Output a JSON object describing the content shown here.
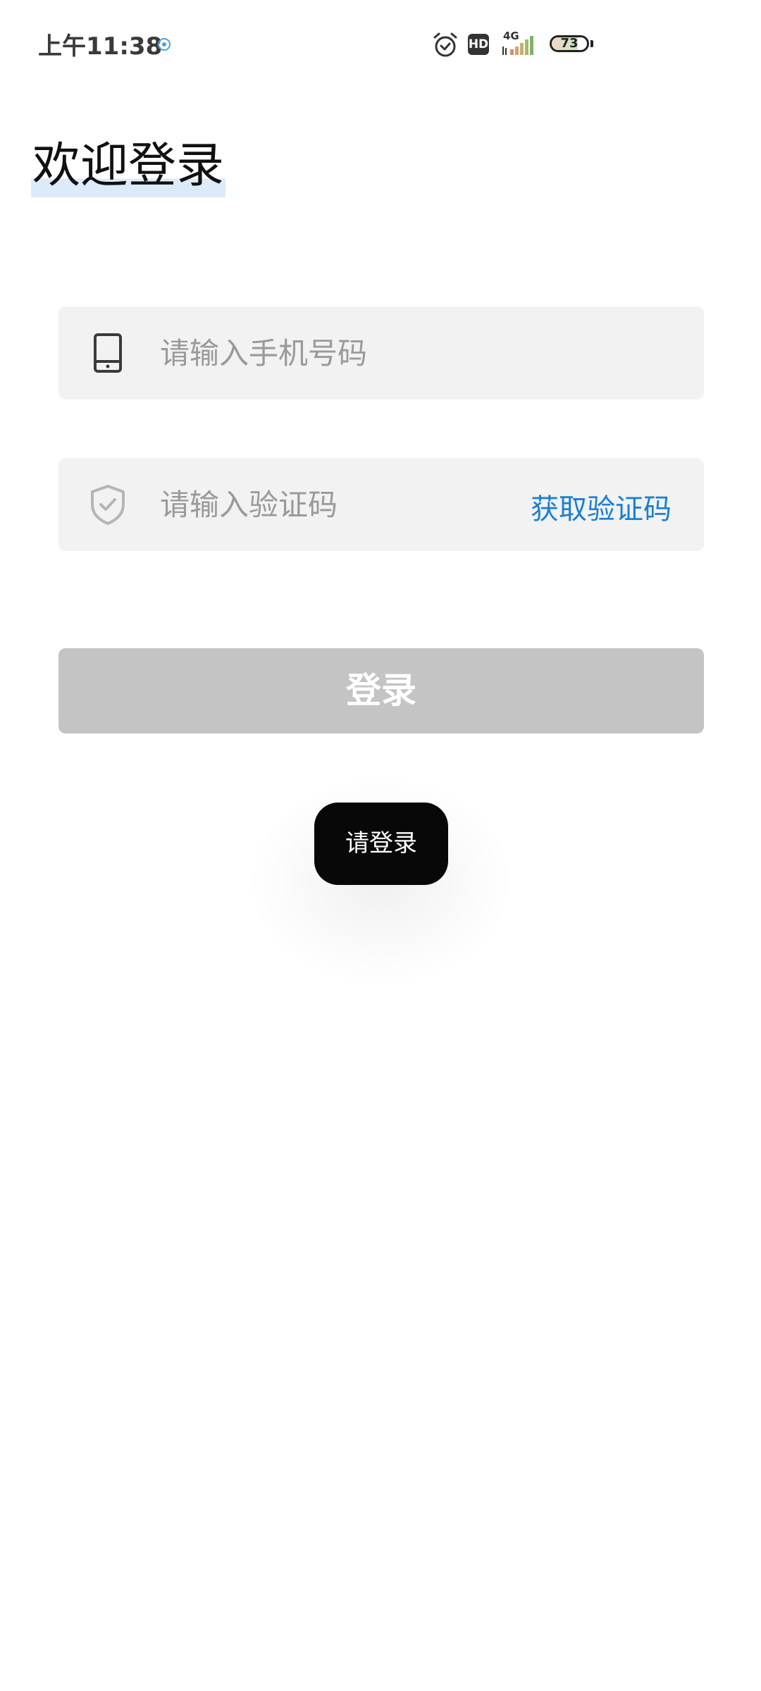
{
  "status_bar": {
    "time": "上午11:38",
    "network": "4G",
    "battery": "73",
    "battery_level": 0.73,
    "icons": [
      "notification-icon",
      "alarm-icon",
      "hd-icon",
      "signal-icon",
      "battery-icon"
    ]
  },
  "page": {
    "title": "欢迎登录"
  },
  "phone_field": {
    "placeholder": "请输入手机号码",
    "value": "",
    "icon": "phone-icon"
  },
  "code_field": {
    "placeholder": "请输入验证码",
    "value": "",
    "icon": "shield-check-icon",
    "get_code_label": "获取验证码"
  },
  "login_button": {
    "label": "登录"
  },
  "toast": {
    "message": "请登录"
  },
  "colors": {
    "accent": "#1a7fd4",
    "button_disabled": "#c4c4c4",
    "input_background": "#f2f2f2",
    "toast_background": "#080808"
  }
}
